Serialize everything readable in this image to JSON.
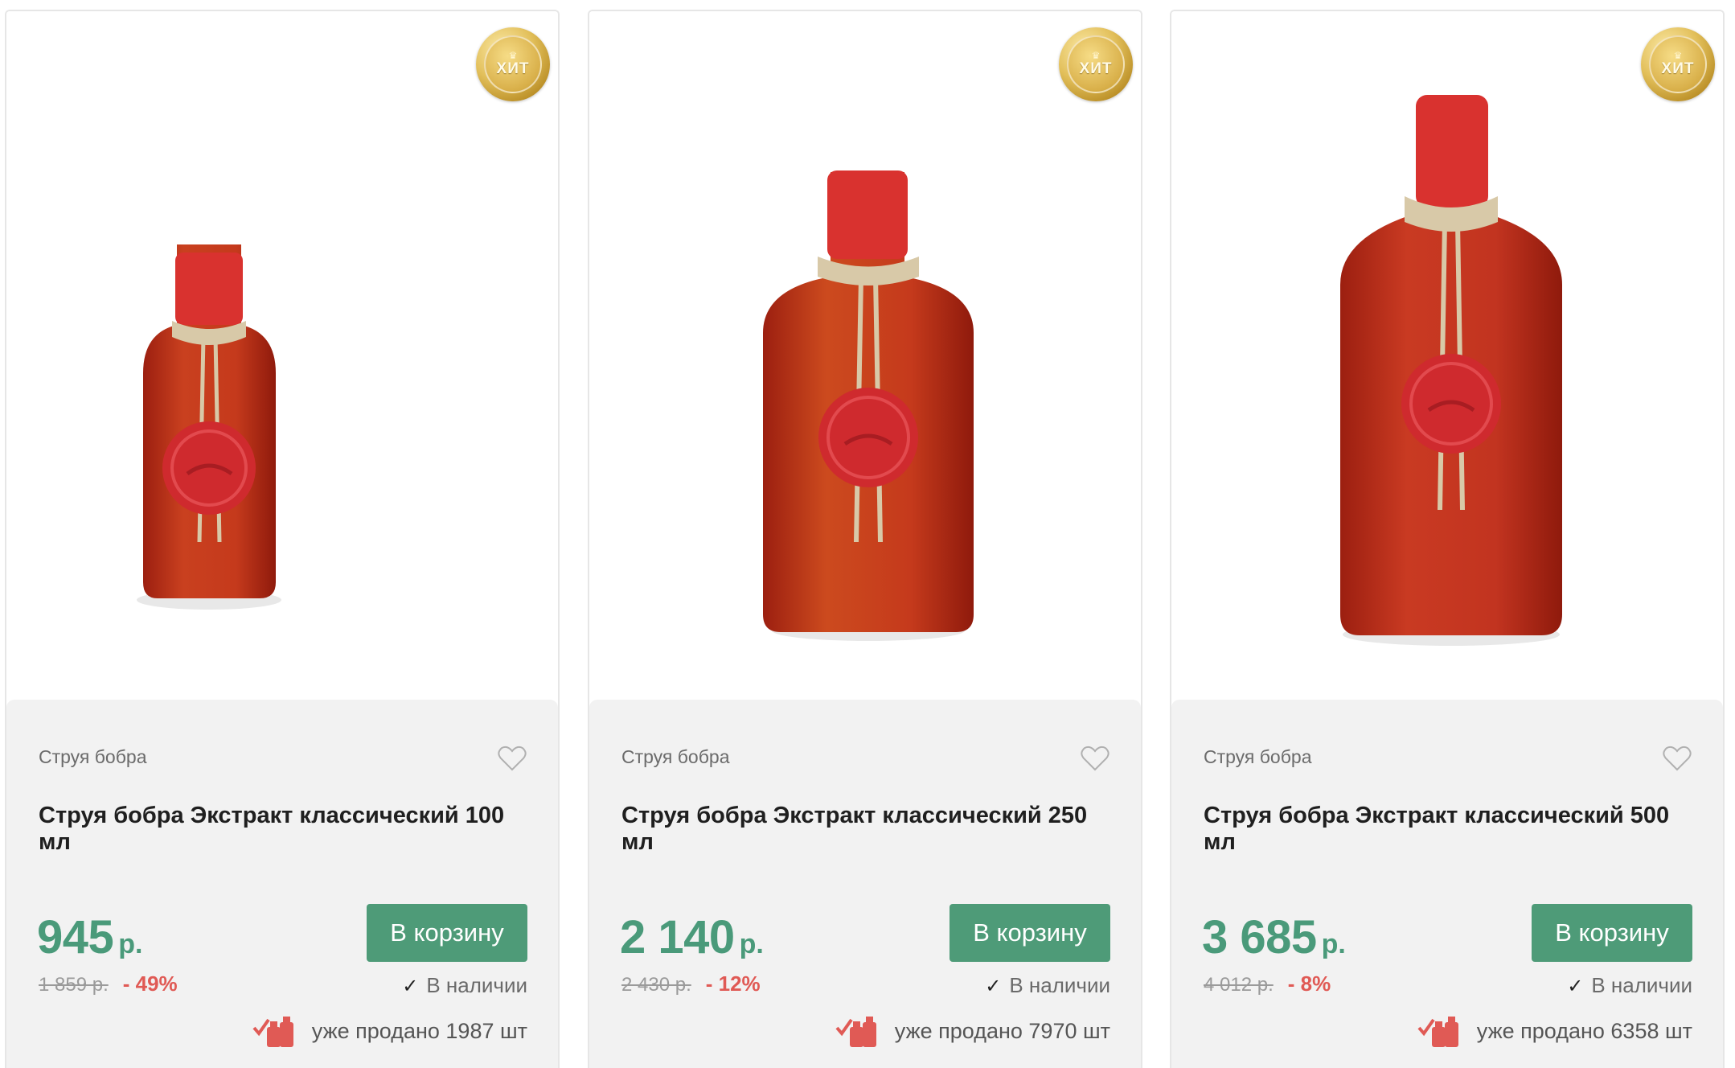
{
  "products": [
    {
      "badge": "ХИТ",
      "category": "Струя бобра",
      "title": "Струя бобра Экстракт классический 100 мл",
      "price": "945",
      "currency": "р.",
      "old_price": "1 859 р.",
      "discount": "- 49%",
      "cart_label": "В корзину",
      "stock_label": "В наличии",
      "sold_label": "уже продано 1987 шт"
    },
    {
      "badge": "ХИТ",
      "category": "Струя бобра",
      "title": "Струя бобра Экстракт классический 250 мл",
      "price": "2 140",
      "currency": "р.",
      "old_price": "2 430 р.",
      "discount": "- 12%",
      "cart_label": "В корзину",
      "stock_label": "В наличии",
      "sold_label": "уже продано 7970 шт"
    },
    {
      "badge": "ХИТ",
      "category": "Струя бобра",
      "title": "Струя бобра Экстракт классический 500 мл",
      "price": "3 685",
      "currency": "р.",
      "old_price": "4 012 р.",
      "discount": "- 8%",
      "cart_label": "В корзину",
      "stock_label": "В наличии",
      "sold_label": "уже продано 6358 шт"
    }
  ],
  "colors": {
    "accent_green": "#4e9b78",
    "price_green": "#4a9a7a",
    "discount_red": "#e05a55",
    "card_info_bg": "#f2f2f2"
  },
  "icons": {
    "badge": "gold-hit-medal-icon",
    "favorite": "heart-outline-icon",
    "stock": "checkmark-icon",
    "sold": "bottles-sold-icon"
  }
}
